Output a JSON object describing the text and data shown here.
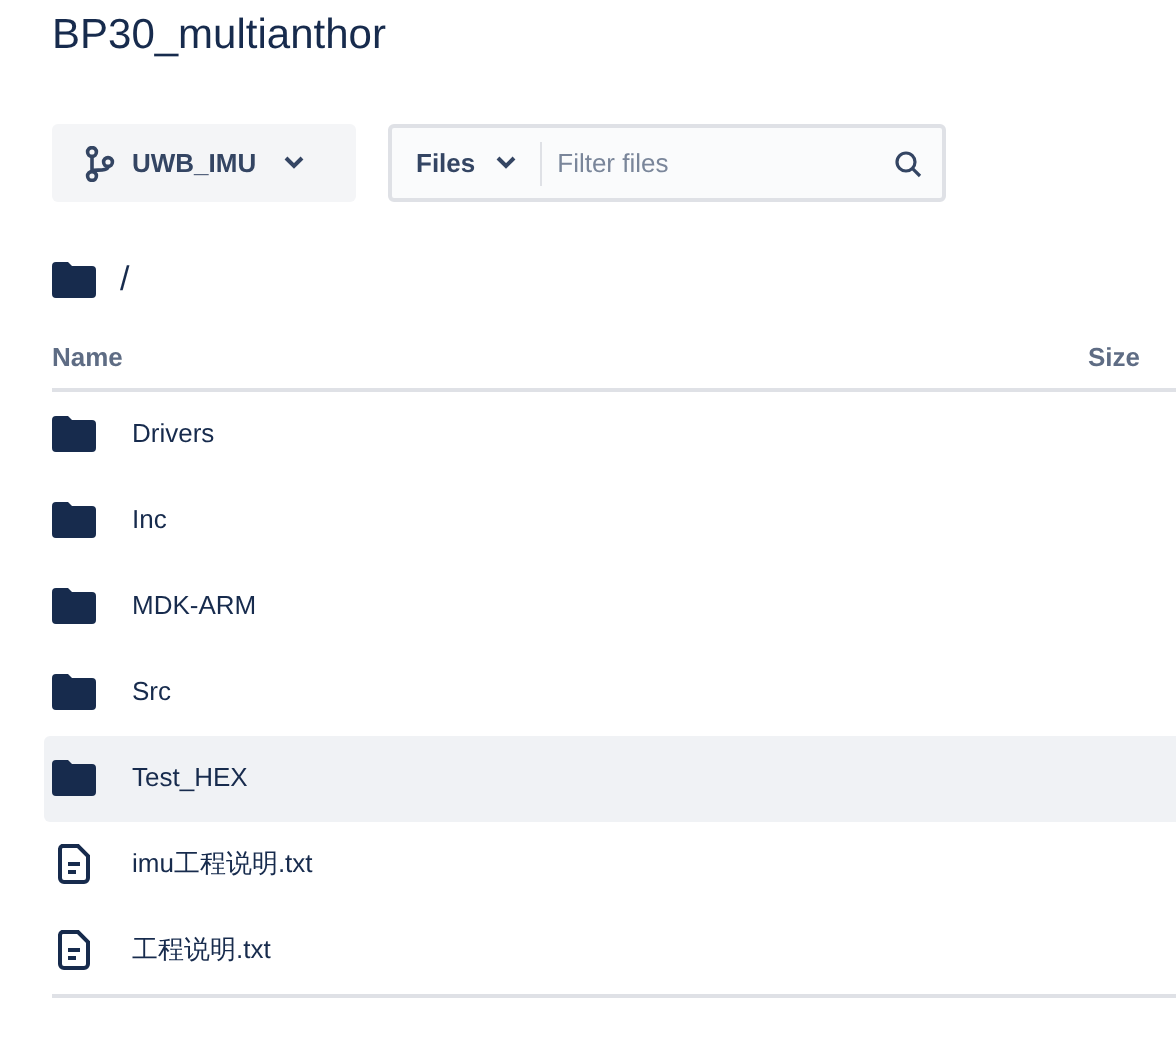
{
  "title": "BP30_multianthor",
  "branch": {
    "label": "UWB_IMU"
  },
  "filter": {
    "scope": "Files",
    "placeholder": "Filter files"
  },
  "path": "/",
  "columns": [
    "Name",
    "Size"
  ],
  "rows": [
    {
      "kind": "folder",
      "name": "Drivers",
      "selected": false
    },
    {
      "kind": "folder",
      "name": "Inc",
      "selected": false
    },
    {
      "kind": "folder",
      "name": "MDK-ARM",
      "selected": false
    },
    {
      "kind": "folder",
      "name": "Src",
      "selected": false
    },
    {
      "kind": "folder",
      "name": "Test_HEX",
      "selected": true
    },
    {
      "kind": "file",
      "name": "imu工程说明.txt",
      "selected": false
    },
    {
      "kind": "file",
      "name": "工程说明.txt",
      "selected": false
    }
  ]
}
